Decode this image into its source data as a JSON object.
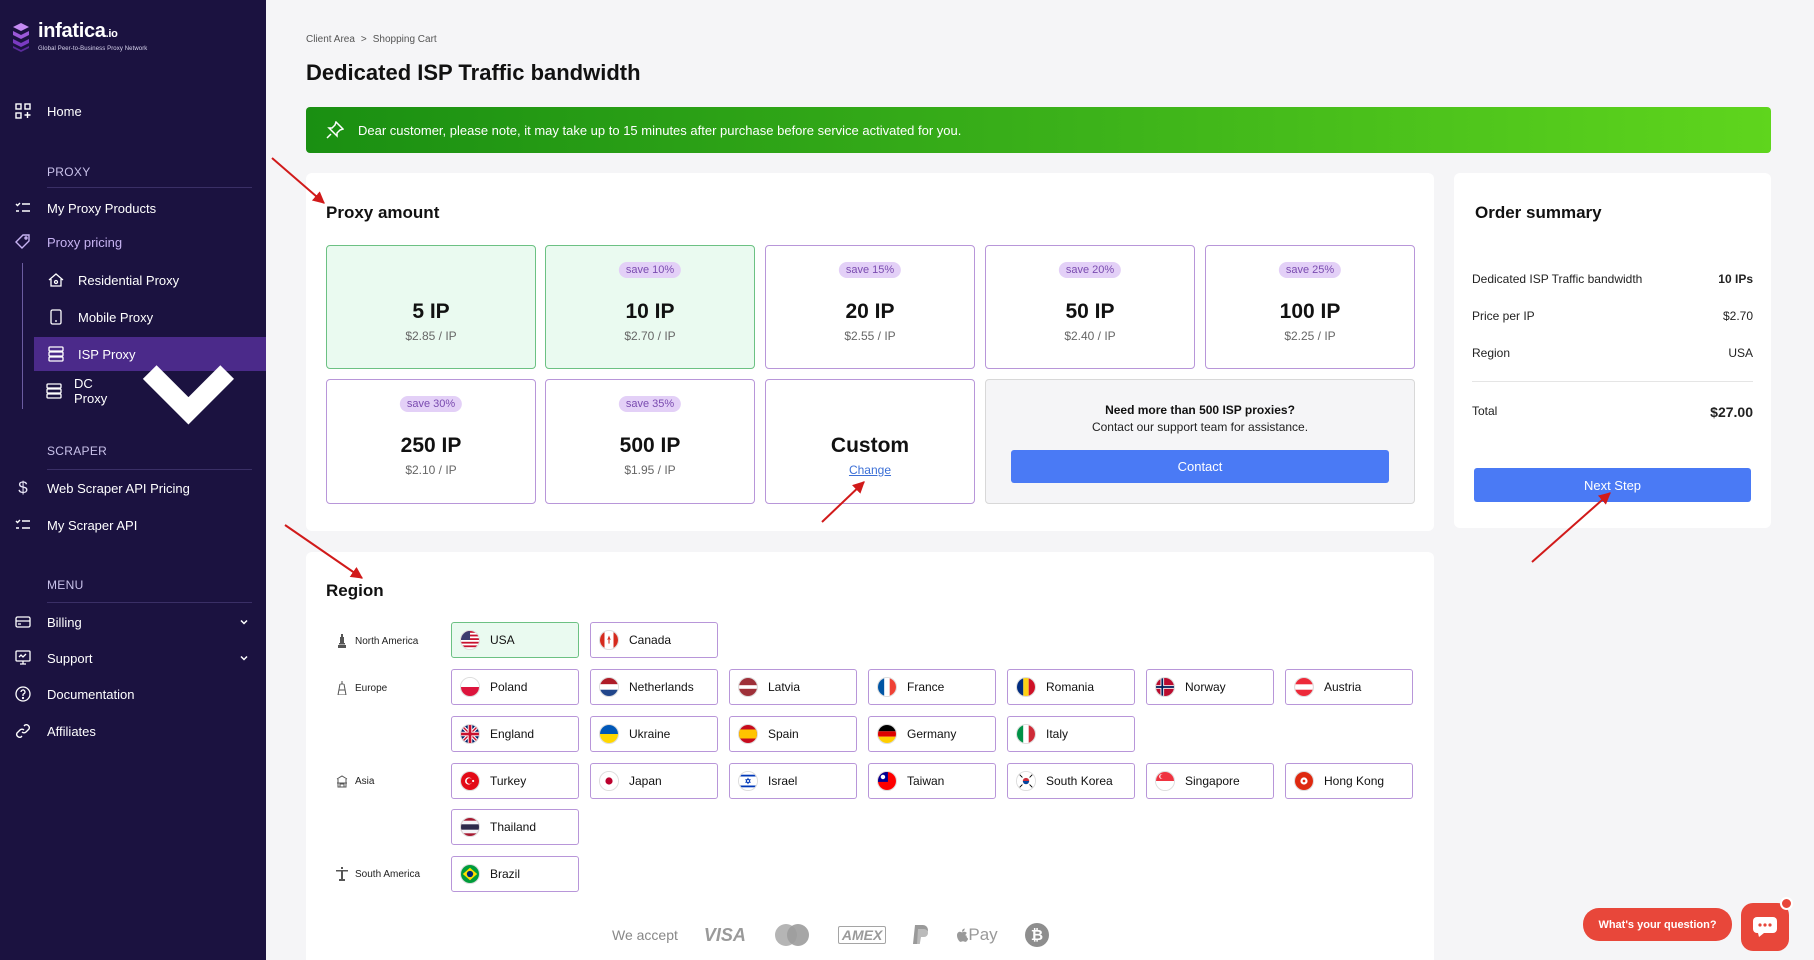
{
  "brand": {
    "name": "infatica",
    "suffix": ".io",
    "tagline": "Global Peer-to-Business Proxy Network"
  },
  "sidebar": {
    "home": "Home",
    "proxy_section": "PROXY",
    "my_proxy_products": "My Proxy Products",
    "proxy_pricing": "Proxy pricing",
    "sub_items": [
      "Residential Proxy",
      "Mobile Proxy",
      "ISP Proxy",
      "DC Proxy"
    ],
    "scraper_section": "SCRAPER",
    "web_scraper_pricing": "Web Scraper API Pricing",
    "my_scraper_api": "My Scraper API",
    "menu_section": "MENU",
    "billing": "Billing",
    "support": "Support",
    "documentation": "Documentation",
    "affiliates": "Affiliates"
  },
  "breadcrumb": {
    "items": [
      "Client Area",
      "Shopping Cart"
    ],
    "separator": ">"
  },
  "page_title": "Dedicated ISP Traffic bandwidth",
  "notice": "Dear customer, please note, it may take up to 15 minutes after purchase before service activated for you.",
  "proxy_amount": {
    "title": "Proxy amount",
    "options": [
      {
        "amount": "5 IP",
        "price": "$2.85 / IP",
        "save": ""
      },
      {
        "amount": "10 IP",
        "price": "$2.70 / IP",
        "save": "save 10%"
      },
      {
        "amount": "20 IP",
        "price": "$2.55 / IP",
        "save": "save 15%"
      },
      {
        "amount": "50 IP",
        "price": "$2.40 / IP",
        "save": "save 20%"
      },
      {
        "amount": "100 IP",
        "price": "$2.25 / IP",
        "save": "save 25%"
      },
      {
        "amount": "250 IP",
        "price": "$2.10 / IP",
        "save": "save 30%"
      },
      {
        "amount": "500 IP",
        "price": "$1.95 / IP",
        "save": "save 35%"
      }
    ],
    "custom": {
      "label": "Custom",
      "link": "Change"
    },
    "more": {
      "title": "Need more than 500 ISP proxies?",
      "text": "Contact our support team for assistance.",
      "button": "Contact"
    }
  },
  "order_summary": {
    "title": "Order summary",
    "rows": [
      {
        "label": "Dedicated ISP Traffic bandwidth",
        "value": "10 IPs"
      },
      {
        "label": "Price per IP",
        "value": "$2.70"
      },
      {
        "label": "Region",
        "value": "USA"
      }
    ],
    "total_label": "Total",
    "total_value": "$27.00",
    "button": "Next Step"
  },
  "region": {
    "title": "Region",
    "groups": [
      "North America",
      "Europe",
      "Asia",
      "South America"
    ],
    "countries": [
      "USA",
      "Canada",
      "Poland",
      "Netherlands",
      "Latvia",
      "France",
      "Romania",
      "Norway",
      "Austria",
      "England",
      "Ukraine",
      "Spain",
      "Germany",
      "Italy",
      "Turkey",
      "Japan",
      "Israel",
      "Taiwan",
      "South Korea",
      "Singapore",
      "Hong Kong",
      "Thailand",
      "Brazil"
    ]
  },
  "payments": {
    "label": "We accept",
    "methods": [
      "VISA",
      "mastercard-icon",
      "AMEX",
      "paypal-icon",
      "Pay",
      "bitcoin-icon"
    ]
  },
  "chat": {
    "prompt": "What's your question?"
  },
  "colors": {
    "sidebar_bg": "#1b1240",
    "active_nav": "#4b2a8a",
    "primary_button": "#4a7af5",
    "notice_green": "#3db31a",
    "selected_border": "#6cc183",
    "option_border": "#b896d9",
    "chat_red": "#e8473a"
  }
}
